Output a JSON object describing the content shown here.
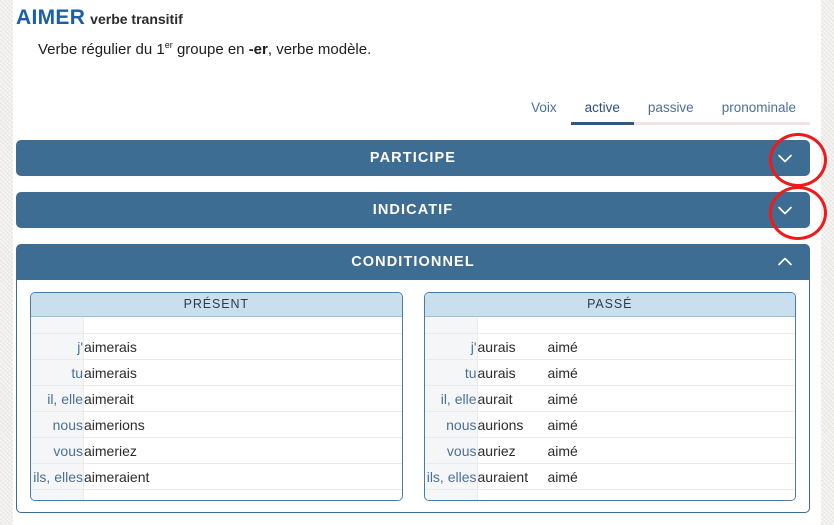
{
  "header": {
    "verb": "AIMER",
    "verb_kind": "verbe transitif",
    "description_prefix": "Verbe régulier du 1",
    "description_sup": "er",
    "description_mid": " groupe en ",
    "description_bold": "-er",
    "description_suffix": ", verbe modèle."
  },
  "voice": {
    "label": "Voix",
    "tabs": [
      {
        "label": "active",
        "selected": true
      },
      {
        "label": "passive",
        "selected": false
      },
      {
        "label": "pronominale",
        "selected": false
      }
    ]
  },
  "moods": [
    {
      "title": "PARTICIPE",
      "expanded": false,
      "chevron": "chevron-down-icon"
    },
    {
      "title": "INDICATIF",
      "expanded": false,
      "chevron": "chevron-down-icon"
    },
    {
      "title": "CONDITIONNEL",
      "expanded": true,
      "chevron": "chevron-up-icon"
    }
  ],
  "conditionnel": {
    "present": {
      "title": "PRÉSENT",
      "rows": [
        {
          "pronoun": "j'",
          "aux": "",
          "form": "aimerais"
        },
        {
          "pronoun": "tu",
          "aux": "",
          "form": "aimerais"
        },
        {
          "pronoun": "il, elle",
          "aux": "",
          "form": "aimerait"
        },
        {
          "pronoun": "nous",
          "aux": "",
          "form": "aimerions"
        },
        {
          "pronoun": "vous",
          "aux": "",
          "form": "aimeriez"
        },
        {
          "pronoun": "ils, elles",
          "aux": "",
          "form": "aimeraient"
        }
      ]
    },
    "passe": {
      "title": "PASSÉ",
      "rows": [
        {
          "pronoun": "j'",
          "aux": "aurais",
          "form": "aimé"
        },
        {
          "pronoun": "tu",
          "aux": "aurais",
          "form": "aimé"
        },
        {
          "pronoun": "il, elle",
          "aux": "aurait",
          "form": "aimé"
        },
        {
          "pronoun": "nous",
          "aux": "aurions",
          "form": "aimé"
        },
        {
          "pronoun": "vous",
          "aux": "auriez",
          "form": "aimé"
        },
        {
          "pronoun": "ils, elles",
          "aux": "auraient",
          "form": "aimé"
        }
      ]
    }
  },
  "annotations": {
    "color": "#f01a1a",
    "targets": [
      "participe-chevron",
      "indicatif-chevron"
    ]
  },
  "colors": {
    "mood_bar": "#3e6d94",
    "tense_header": "#c9dfed",
    "verb_name": "#1a5fa8",
    "pronoun_text": "#4d6f9a",
    "annotation": "#f01a1a"
  }
}
